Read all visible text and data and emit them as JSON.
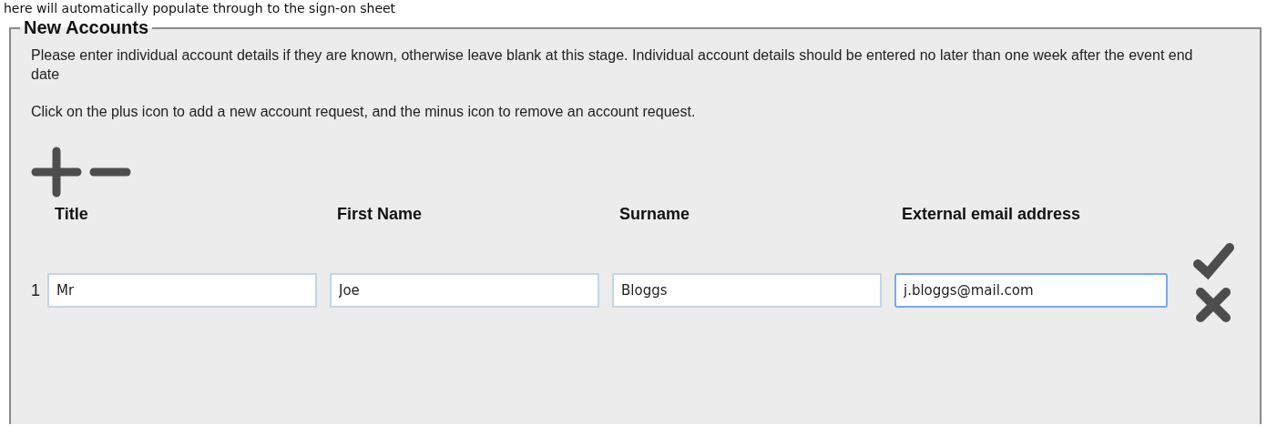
{
  "top_note": "here will automatically populate through to the sign-on sheet",
  "section": {
    "title": "New Accounts",
    "paragraphs": [
      "Please enter individual account details if they are known, otherwise leave blank at this stage. Individual account details should be entered no later than one week after the event end date",
      "Click on the plus icon to add a new account request, and the minus icon to remove an account request."
    ],
    "columns": [
      "Title",
      "First Name",
      "Surname",
      "External email address"
    ],
    "rows": [
      {
        "number": "1",
        "fields": [
          {
            "value": "Mr",
            "focused": false
          },
          {
            "value": "Joe",
            "focused": false
          },
          {
            "value": "Bloggs",
            "focused": false
          },
          {
            "value": "j.bloggs@mail.com",
            "focused": true
          }
        ]
      }
    ]
  }
}
